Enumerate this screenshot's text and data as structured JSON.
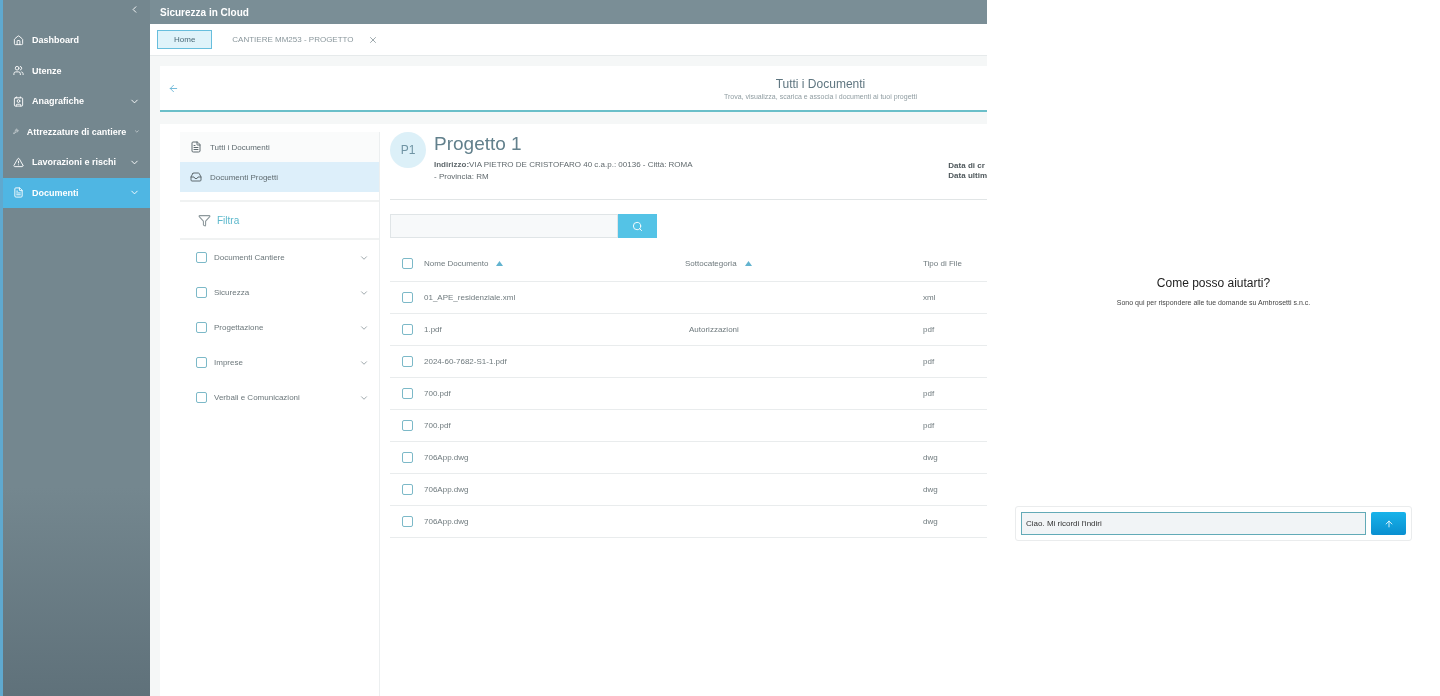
{
  "app": {
    "title": "Sicurezza in Cloud"
  },
  "sidebar": {
    "items": [
      {
        "label": "Dashboard",
        "has_children": false,
        "selected": false
      },
      {
        "label": "Utenze",
        "has_children": false,
        "selected": false
      },
      {
        "label": "Anagrafiche",
        "has_children": true,
        "selected": false
      },
      {
        "label": "Attrezzature di cantiere",
        "has_children": true,
        "selected": false
      },
      {
        "label": "Lavorazioni e rischi",
        "has_children": true,
        "selected": false
      },
      {
        "label": "Documenti",
        "has_children": true,
        "selected": true
      }
    ]
  },
  "tabs": [
    {
      "label": "Home",
      "selected": true,
      "closable": false
    },
    {
      "label": "CANTIERE MM253 - PROGETTO",
      "selected": false,
      "closable": true
    }
  ],
  "header": {
    "title": "Tutti i Documenti",
    "subtitle": "Trova, visualizza, scarica e associa i documenti ai tuoi progetti"
  },
  "doc_nav": [
    {
      "label": "Tutti i Documenti",
      "selected": false
    },
    {
      "label": "Documenti Progetti",
      "selected": true
    }
  ],
  "filter": {
    "label": "Filtra",
    "categories": [
      {
        "label": "Documenti Cantiere",
        "checked": false
      },
      {
        "label": "Sicurezza",
        "checked": false
      },
      {
        "label": "Progettazione",
        "checked": false
      },
      {
        "label": "Imprese",
        "checked": false
      },
      {
        "label": "Verbali e Comunicazioni",
        "checked": false
      }
    ]
  },
  "project": {
    "avatar": "P1",
    "name": "Progetto 1",
    "address_label": "Indirizzo:",
    "address": "VIA PIETRO DE CRISTOFARO 40 c.a.p.: 00136 - Città: ROMA - Provincia: RM",
    "dates": [
      "Data di cr",
      "Data ultim"
    ]
  },
  "table": {
    "select_all": false,
    "columns": [
      {
        "label": "Nome Documento",
        "kind": "sortable"
      },
      {
        "label": "Sottocategoria",
        "kind": "sortable"
      },
      {
        "label": "Tipo di File",
        "kind": "plain"
      }
    ],
    "rows": [
      {
        "checked": false,
        "cells": [
          "01_APE_residenziale.xml",
          "",
          "xml"
        ]
      },
      {
        "checked": false,
        "cells": [
          "1.pdf",
          "Autorizzazioni",
          "pdf"
        ]
      },
      {
        "checked": false,
        "cells": [
          "2024-60-7682-S1-1.pdf",
          "",
          "pdf"
        ]
      },
      {
        "checked": false,
        "cells": [
          "700.pdf",
          "",
          "pdf"
        ]
      },
      {
        "checked": false,
        "cells": [
          "700.pdf",
          "",
          "pdf"
        ]
      },
      {
        "checked": false,
        "cells": [
          "706App.dwg",
          "",
          "dwg"
        ]
      },
      {
        "checked": false,
        "cells": [
          "706App.dwg",
          "",
          "dwg"
        ]
      },
      {
        "checked": false,
        "cells": [
          "706App.dwg",
          "",
          "dwg"
        ]
      }
    ]
  },
  "chat": {
    "title": "Come posso aiutarti?",
    "subtitle": "Sono qui per rispondere alle tue domande su Ambrosetti s.n.c.",
    "input_value": "Ciao. Mi ricordi l'indiri"
  }
}
